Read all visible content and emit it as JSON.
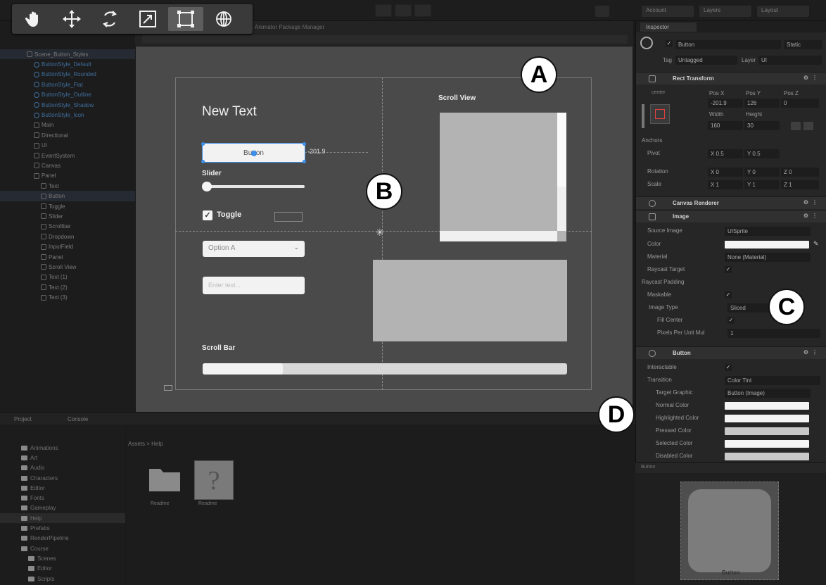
{
  "toolbar": {
    "tools": [
      {
        "name": "hand-tool-icon",
        "active": false
      },
      {
        "name": "move-tool-icon",
        "active": false
      },
      {
        "name": "rotate-tool-icon",
        "active": false
      },
      {
        "name": "scale-tool-icon",
        "active": false
      },
      {
        "name": "rect-tool-icon",
        "active": true
      },
      {
        "name": "transform-tool-icon",
        "active": false
      }
    ],
    "account_label": "Account",
    "layers_label": "Layers",
    "layout_label": "Layout"
  },
  "hierarchy": {
    "items": [
      {
        "label": "Scene_Button_Styles",
        "indent": 0,
        "blue": false,
        "sel": true
      },
      {
        "label": "ButtonStyle_Default",
        "indent": 1,
        "blue": true
      },
      {
        "label": "ButtonStyle_Rounded",
        "indent": 1,
        "blue": true
      },
      {
        "label": "ButtonStyle_Flat",
        "indent": 1,
        "blue": true
      },
      {
        "label": "ButtonStyle_Outline",
        "indent": 1,
        "blue": true
      },
      {
        "label": "ButtonStyle_Shadow",
        "indent": 1,
        "blue": true
      },
      {
        "label": "ButtonStyle_Icon",
        "indent": 1,
        "blue": true
      },
      {
        "label": "Main",
        "indent": 1
      },
      {
        "label": "Directional",
        "indent": 1
      },
      {
        "label": "UI",
        "indent": 1
      },
      {
        "label": "EventSystem",
        "indent": 1
      },
      {
        "label": "Canvas",
        "indent": 1
      },
      {
        "label": "Panel",
        "indent": 1
      },
      {
        "label": "Text",
        "indent": 2
      },
      {
        "label": "Button",
        "indent": 2,
        "sel": true
      },
      {
        "label": "Toggle",
        "indent": 2
      },
      {
        "label": "Slider",
        "indent": 2
      },
      {
        "label": "Scrollbar",
        "indent": 2
      },
      {
        "label": "Dropdown",
        "indent": 2
      },
      {
        "label": "InputField",
        "indent": 2
      },
      {
        "label": "Panel",
        "indent": 2
      },
      {
        "label": "Scroll View",
        "indent": 2
      },
      {
        "label": "Text (1)",
        "indent": 2
      },
      {
        "label": "Text (2)",
        "indent": 2
      },
      {
        "label": "Text (3)",
        "indent": 2
      }
    ]
  },
  "scene": {
    "tab_label": "Animator   Package Manager",
    "new_text": "New Text",
    "button_text": "Button",
    "pos_label": "-201.9",
    "slider_label": "Slider",
    "slider_value": 0,
    "toggle_label": "Toggle",
    "toggle_checked": true,
    "dropdown_value": "Option A",
    "input_placeholder": "Enter text...",
    "scroll_view_label": "Scroll View",
    "scroll_bar_label": "Scroll Bar",
    "scroll_bar_value": 0.22
  },
  "callouts": {
    "a": "A",
    "b": "B",
    "c": "C",
    "d": "D"
  },
  "inspector": {
    "tab": "Inspector",
    "object_name": "Button",
    "static_label": "Static",
    "tag_label": "Tag",
    "tag_value": "Untagged",
    "layer_label": "Layer",
    "layer_value": "UI",
    "rect_transform": {
      "title": "Rect Transform",
      "anchor_label": "center",
      "posx_label": "Pos X",
      "posy_label": "Pos Y",
      "posz_label": "Pos Z",
      "posx": "-201.9",
      "posy": "126",
      "posz": "0",
      "width_label": "Width",
      "height_label": "Height",
      "width": "160",
      "height": "30",
      "anchors_label": "Anchors",
      "pivot_label": "Pivot",
      "pivot_x": "X 0.5",
      "pivot_y": "Y 0.5",
      "rotation_label": "Rotation",
      "rot_x": "X 0",
      "rot_y": "Y 0",
      "rot_z": "Z 0",
      "scale_label": "Scale",
      "scale_x": "X 1",
      "scale_y": "Y 1",
      "scale_z": "Z 1"
    },
    "canvas_renderer": {
      "title": "Canvas Renderer"
    },
    "image": {
      "title": "Image",
      "source_label": "Source Image",
      "source_value": "UISprite",
      "color_label": "Color",
      "material_label": "Material",
      "material_value": "None (Material)",
      "raycast_label": "Raycast Target",
      "raycast_padding_label": "Raycast Padding",
      "maskable_label": "Maskable",
      "image_type_label": "Image Type",
      "image_type_value": "Sliced",
      "fill_center_label": "Fill Center",
      "ppu_label": "Pixels Per Unit Mul",
      "ppu_value": "1"
    },
    "button": {
      "title": "Button",
      "interactable_label": "Interactable",
      "transition_label": "Transition",
      "transition_value": "Color Tint",
      "target_label": "Target Graphic",
      "target_value": "Button (Image)",
      "normal_label": "Normal Color",
      "highlighted_label": "Highlighted Color",
      "pressed_label": "Pressed Color",
      "selected_label": "Selected Color",
      "disabled_label": "Disabled Color"
    }
  },
  "preview": {
    "title": "Button",
    "label": "Button"
  },
  "project": {
    "tab_project": "Project",
    "tab_console": "Console",
    "breadcrumb": "Assets > Help",
    "folders": [
      {
        "label": "Animations"
      },
      {
        "label": "Art"
      },
      {
        "label": "Audio"
      },
      {
        "label": "Characters"
      },
      {
        "label": "Editor"
      },
      {
        "label": "Fonts"
      },
      {
        "label": "Gameplay"
      },
      {
        "label": "Help",
        "sel": true
      },
      {
        "label": "Prefabs"
      },
      {
        "label": "RenderPipeline"
      },
      {
        "label": "Course"
      },
      {
        "label": "Scenes"
      },
      {
        "label": "Editor"
      },
      {
        "label": "Scripts"
      }
    ],
    "assets": [
      {
        "label": "Readme"
      },
      {
        "label": "Readme"
      }
    ]
  },
  "colors": {
    "accent": "#3c8ee8",
    "scene_bg": "#4a4a4a",
    "panel": "#262626"
  }
}
